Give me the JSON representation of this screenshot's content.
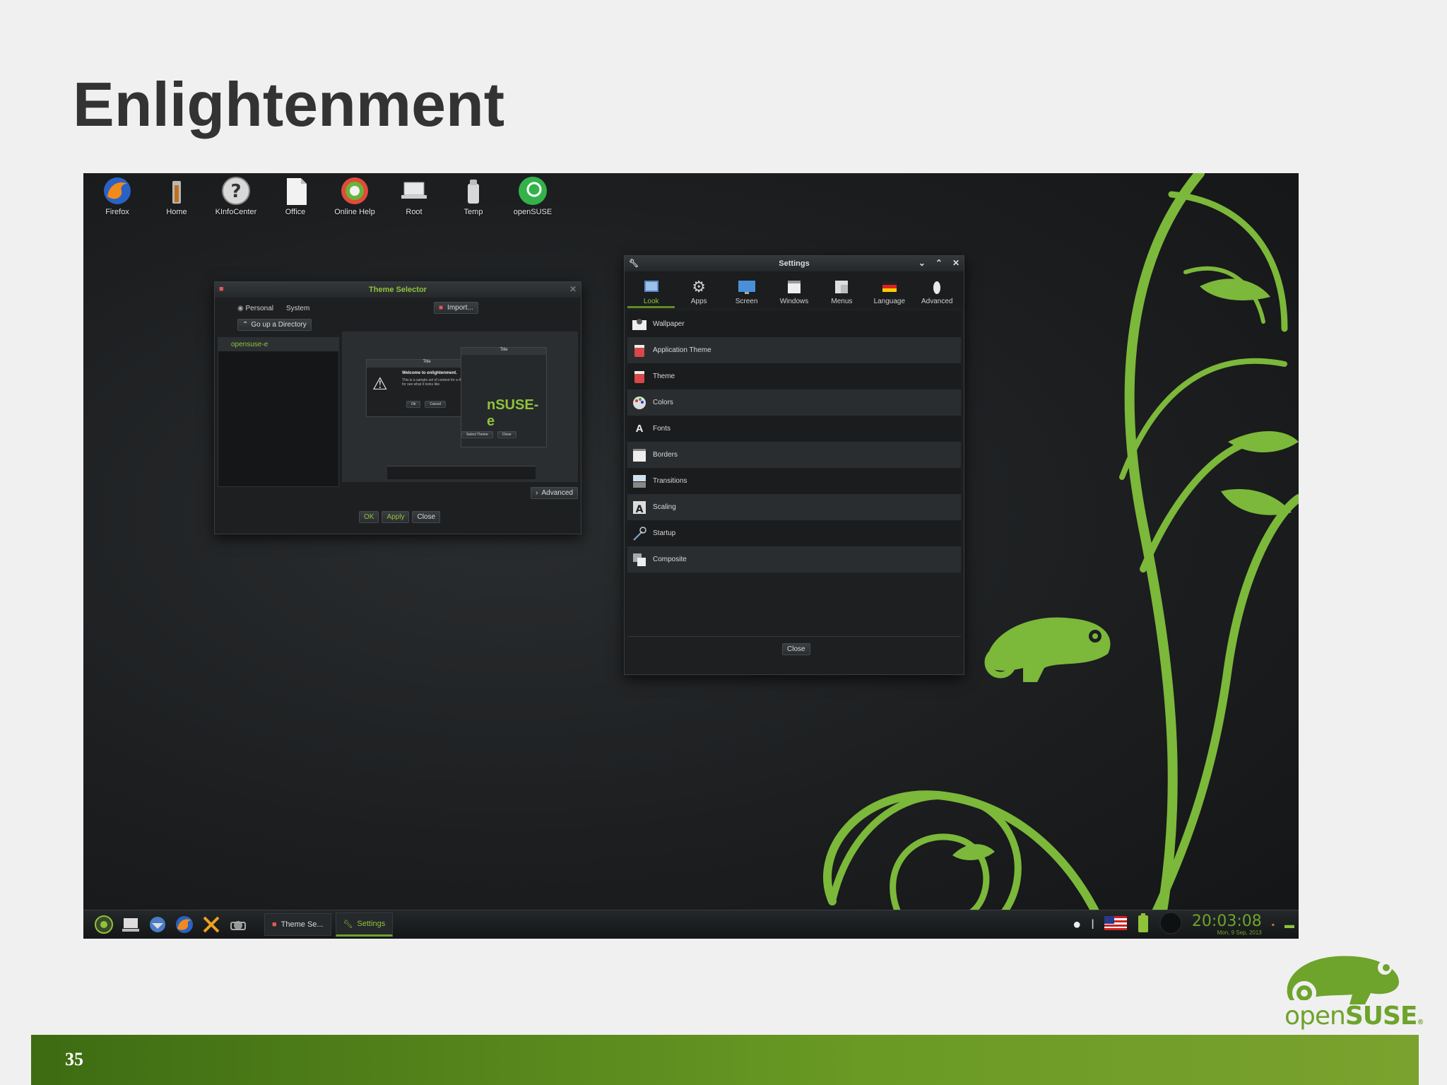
{
  "slide": {
    "title": "Enlightenment",
    "page_number": "35"
  },
  "desktop_icons": [
    {
      "label": "Firefox",
      "icon": "firefox-icon"
    },
    {
      "label": "Home",
      "icon": "home-icon"
    },
    {
      "label": "KInfoCenter",
      "icon": "help-icon"
    },
    {
      "label": "Office",
      "icon": "document-icon"
    },
    {
      "label": "Online Help",
      "icon": "lifebuoy-icon"
    },
    {
      "label": "Root",
      "icon": "laptop-icon"
    },
    {
      "label": "Temp",
      "icon": "trash-icon"
    },
    {
      "label": "openSUSE",
      "icon": "opensuse-icon"
    }
  ],
  "theme_selector": {
    "title": "Theme Selector",
    "tabs": [
      "Personal",
      "System"
    ],
    "go_up": "Go up a Directory",
    "import": "Import...",
    "selected_theme": "opensuse-e",
    "advanced": "Advanced",
    "buttons": {
      "ok": "OK",
      "apply": "Apply",
      "close": "Close"
    },
    "preview": {
      "dialog_title": "Title",
      "dialog_heading": "Welcome to enlightenment.",
      "dialog_text": "This is a sample set of content for a theme to test for see what it looks like.",
      "ok": "Ok",
      "cancel": "Cancel",
      "brand_text": "nSUSE-e",
      "select_theme": "Select Theme",
      "close": "Close"
    }
  },
  "settings": {
    "title": "Settings",
    "tabs": [
      {
        "label": "Look",
        "icon": "look-icon"
      },
      {
        "label": "Apps",
        "icon": "gear-icon"
      },
      {
        "label": "Screen",
        "icon": "monitor-icon"
      },
      {
        "label": "Windows",
        "icon": "window-icon"
      },
      {
        "label": "Menus",
        "icon": "menu-icon"
      },
      {
        "label": "Language",
        "icon": "flag-icon"
      },
      {
        "label": "Advanced",
        "icon": "advanced-icon"
      }
    ],
    "active_tab": "Look",
    "items": [
      {
        "label": "Wallpaper",
        "icon": "wallpaper-icon"
      },
      {
        "label": "Application Theme",
        "icon": "paint-bucket-icon"
      },
      {
        "label": "Theme",
        "icon": "theme-icon"
      },
      {
        "label": "Colors",
        "icon": "palette-icon"
      },
      {
        "label": "Fonts",
        "icon": "fonts-icon"
      },
      {
        "label": "Borders",
        "icon": "borders-icon"
      },
      {
        "label": "Transitions",
        "icon": "transitions-icon"
      },
      {
        "label": "Scaling",
        "icon": "scaling-icon"
      },
      {
        "label": "Startup",
        "icon": "startup-icon"
      },
      {
        "label": "Composite",
        "icon": "composite-icon"
      }
    ],
    "close": "Close"
  },
  "taskbar": {
    "launchers": [
      "start-menu-icon",
      "computer-icon",
      "mail-icon",
      "firefox-icon",
      "chat-icon",
      "screenshot-icon"
    ],
    "tasks": [
      {
        "label": "Theme Se...",
        "active": false
      },
      {
        "label": "Settings",
        "active": true
      }
    ],
    "clock_time": "20:03:08",
    "clock_date": "Mon, 9 Sep, 2013"
  },
  "logo": {
    "open": "open",
    "suse": "SUSE",
    "mark": "®"
  },
  "colors": {
    "accent": "#8fc33a",
    "footer_green": "#5a8a1c",
    "title": "#333333"
  }
}
